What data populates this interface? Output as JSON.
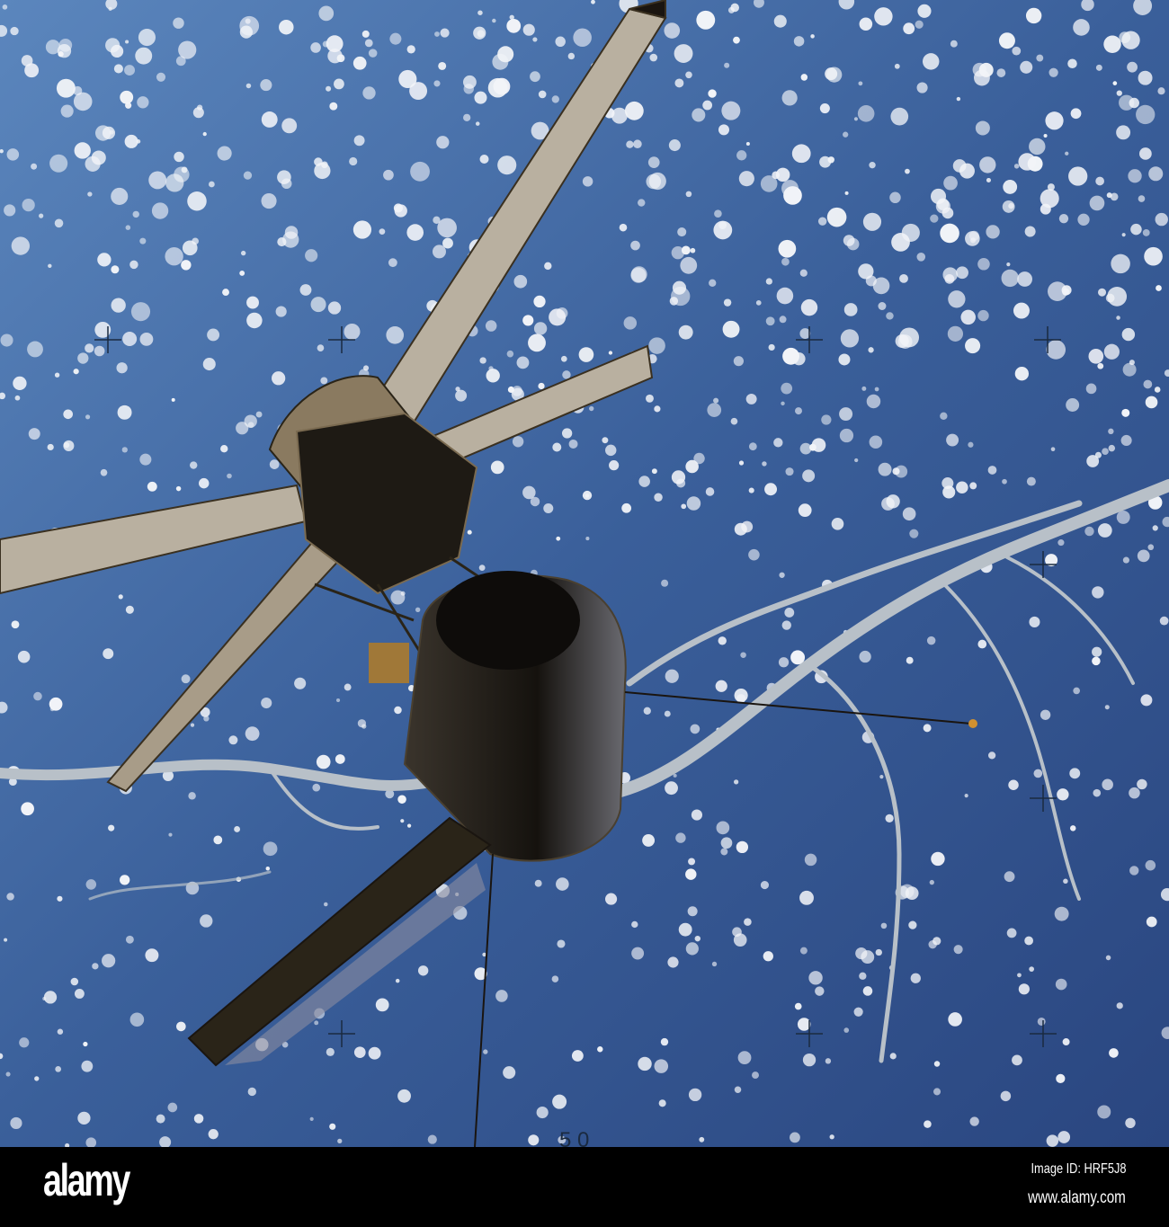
{
  "image": {
    "subject": "skylab-space-station",
    "colors": {
      "ocean": "#3a5f9a",
      "ocean_dark": "#24407a",
      "cloud": "#f2f4f8",
      "river": "#b8c0c8",
      "panel": "#b9b0a0",
      "hull": "#1a1510"
    }
  },
  "watermark": {
    "logo": "alamy",
    "image_id": "Image ID: HRF5J8",
    "website": "www.alamy.com"
  }
}
